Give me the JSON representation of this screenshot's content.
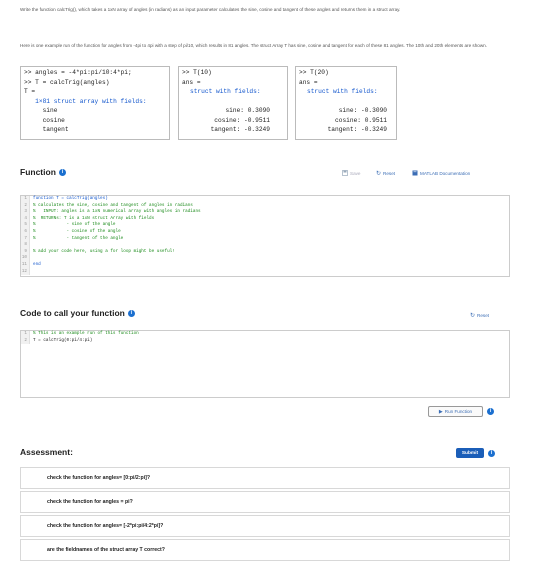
{
  "intro": {
    "line1": "Write the function calcTrig(), which takes a 1xN array of angles (in radians) as an input parameter calculates the sine, cosine and tangent of these angles and returns them in a struct array.",
    "line2": "Here is one example run of the function for angles from -4pi to 4pi with a step of pi/10, which results in 81 angles.  The struct Array T has  sine, cosine and tangent for each of these 81 angles. The 10th and 20th elements are shown."
  },
  "cmd1": {
    "lines": [
      ">> angles = -4*pi:pi/10:4*pi;",
      ">> T = calcTrig(angles)",
      "T =",
      "   1×81 struct array with fields:",
      "     sine",
      "     cosine",
      "     tangent"
    ]
  },
  "cmd2": {
    "prompt": ">> T(10)",
    "ans": "ans =",
    "struct": "struct with fields:",
    "rows": [
      "sine: 0.3090",
      "cosine: -0.9511",
      "tangent: -0.3249"
    ]
  },
  "cmd3": {
    "prompt": ">> T(20)",
    "ans": "ans =",
    "struct": "struct with fields:",
    "rows": [
      "sine: -0.3090",
      "cosine: 0.9511",
      "tangent: -0.3249"
    ]
  },
  "function_section": {
    "title": "Function",
    "save": "Save",
    "reset": "Reset",
    "docs": "MATLAB Documentation",
    "code": [
      "function T = calcTrig(angles)",
      "% calculates the sine, cosine and tangent of angles in radians",
      "%   INPUT: angles is a 1xN numerical array with angles in radians",
      "%  RETURNs: T is a 1xN struct Array with fields",
      "%            - sine of the angle",
      "%            - cosine of the angle",
      "%            - tangent of the angle",
      "",
      "% add your code here, using a for loop might be useful!",
      "",
      "end",
      ""
    ]
  },
  "call_section": {
    "title": "Code to call your function",
    "reset": "Reset",
    "code": [
      "% This is an example run of this function",
      "T = calcTrig(0:pi/4:pi)"
    ],
    "run": "Run Function"
  },
  "assessment": {
    "title": "Assessment:",
    "submit": "Submit",
    "checks": [
      "check the function for angles= [0:pi/2:pi]?",
      "check the function for angles = pi?",
      "check the function for angles= [-2*pi:pi/4:2*pi]?",
      "are the fieldnames of the struct array T correct?"
    ]
  }
}
